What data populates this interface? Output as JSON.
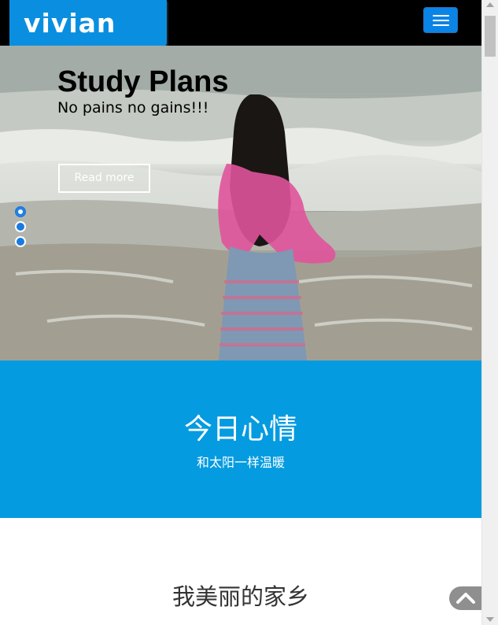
{
  "navbar": {
    "logo_text": "vivian",
    "menu_icon": "hamburger-icon",
    "brand_color": "#0a8fe0"
  },
  "hero": {
    "title": "Study Plans",
    "subtitle": "No pains no gains!!!",
    "button_label": "Read more",
    "slides_total": 3,
    "active_slide": 1
  },
  "mood": {
    "title": "今日心情",
    "subtitle": "和太阳一样温暖",
    "background_color": "#049be0"
  },
  "section": {
    "title": "我美丽的家乡"
  },
  "back_to_top": {
    "icon": "chevron-up-icon"
  }
}
